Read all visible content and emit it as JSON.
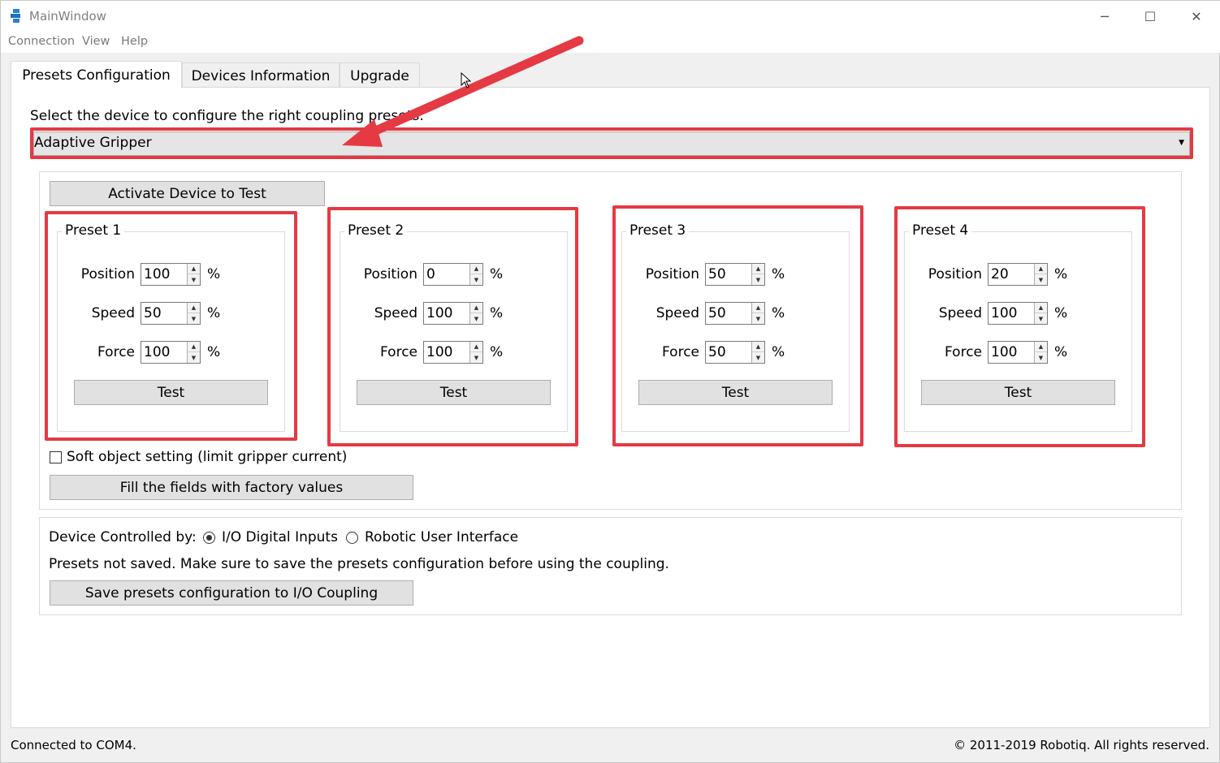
{
  "window": {
    "title": "MainWindow",
    "icon": "robotiq-app-icon",
    "controls": {
      "minimize": "─",
      "maximize": "☐",
      "close": "✕"
    }
  },
  "menu": [
    "Connection",
    "View",
    "Help"
  ],
  "tabs": [
    {
      "label": "Presets Configuration",
      "active": true
    },
    {
      "label": "Devices Information",
      "active": false
    },
    {
      "label": "Upgrade",
      "active": false
    }
  ],
  "device_select": {
    "prompt": "Select the device to configure the right coupling presets:",
    "selected": "Adaptive Gripper"
  },
  "activate_button": "Activate Device to Test",
  "presets": [
    {
      "title": "Preset 1",
      "position": "100",
      "speed": "50",
      "force": "100"
    },
    {
      "title": "Preset 2",
      "position": "0",
      "speed": "100",
      "force": "100"
    },
    {
      "title": "Preset 3",
      "position": "50",
      "speed": "50",
      "force": "50"
    },
    {
      "title": "Preset 4",
      "position": "20",
      "speed": "100",
      "force": "100"
    }
  ],
  "field_labels": {
    "position": "Position",
    "speed": "Speed",
    "force": "Force",
    "unit": "%"
  },
  "test_button": "Test",
  "soft_object": {
    "label": "Soft object setting (limit gripper current)",
    "checked": false
  },
  "factory_button": "Fill the fields with factory values",
  "control": {
    "label": "Device Controlled by:",
    "options": [
      {
        "label": "I/O Digital Inputs",
        "checked": true
      },
      {
        "label": "Robotic User Interface",
        "checked": false
      }
    ]
  },
  "warning": "Presets not saved. Make sure to save the presets configuration before using the coupling.",
  "save_button": "Save presets configuration to I/O Coupling",
  "status": {
    "left": "Connected to COM4.",
    "right": "© 2011-2019 Robotiq. All rights reserved."
  },
  "annotation_color": "#e53a43"
}
